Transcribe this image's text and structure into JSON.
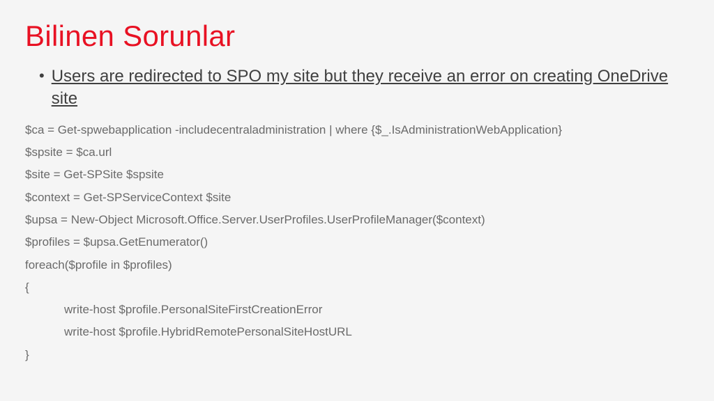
{
  "title": "Bilinen Sorunlar",
  "bullet": {
    "marker": "•",
    "text": "Users are redirected to SPO my site but they receive an error on creating OneDrive site"
  },
  "code": {
    "l1": "$ca = Get-spwebapplication -includecentraladministration | where {$_.IsAdministrationWebApplication}",
    "l2": "$spsite = $ca.url",
    "l3": "$site = Get-SPSite $spsite",
    "l4": "$context = Get-SPServiceContext $site",
    "l5": "$upsa = New-Object Microsoft.Office.Server.UserProfiles.UserProfileManager($context)",
    "l6": "$profiles = $upsa.GetEnumerator()",
    "l7": "foreach($profile in $profiles)",
    "l8": "{",
    "l9": "write-host $profile.PersonalSiteFirstCreationError",
    "l10": "write-host $profile.HybridRemotePersonalSiteHostURL",
    "l11": "}"
  }
}
